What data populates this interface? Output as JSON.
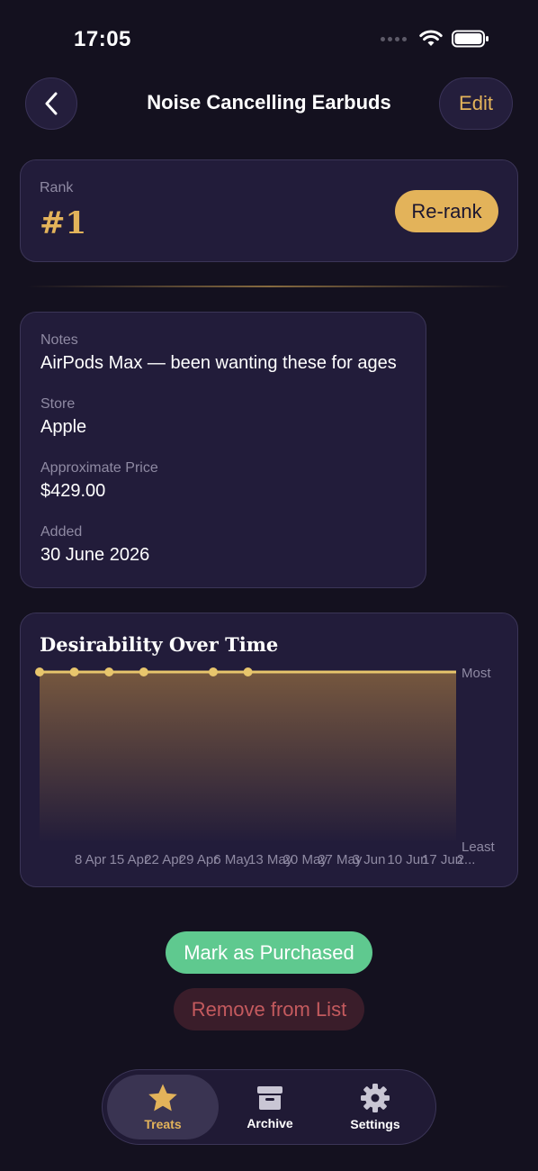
{
  "status": {
    "time": "17:05"
  },
  "nav": {
    "title": "Noise Cancelling Earbuds",
    "edit_label": "Edit"
  },
  "rank": {
    "label": "Rank",
    "value": "#1",
    "rerank_label": "Re-rank"
  },
  "details": [
    {
      "label": "Notes",
      "value": "AirPods Max — been wanting these for ages"
    },
    {
      "label": "Store",
      "value": "Apple"
    },
    {
      "label": "Approximate Price",
      "value": "$429.00"
    },
    {
      "label": "Added",
      "value": "30 June 2026"
    }
  ],
  "chart_data": {
    "type": "area",
    "title": "Desirability Over Time",
    "y_top_label": "Most",
    "y_bottom_label": "Least",
    "x_tick_labels": [
      "8 Apr",
      "15 Apr",
      "22 Apr",
      "29 Apr",
      "6 May",
      "13 May",
      "20 May",
      "27 May",
      "3 Jun",
      "10 Jun",
      "17 Jun",
      "2..."
    ],
    "point_indices": [
      0,
      1,
      2,
      3,
      5,
      6
    ],
    "values": [
      1,
      1,
      1,
      1,
      1,
      1
    ],
    "ylim": [
      0,
      1
    ],
    "line_color": "#e8c56c"
  },
  "actions": {
    "purchase_label": "Mark as Purchased",
    "remove_label": "Remove from List"
  },
  "tabs": [
    {
      "label": "Treats",
      "icon": "star-icon",
      "active": true
    },
    {
      "label": "Archive",
      "icon": "archive-box-icon",
      "active": false
    },
    {
      "label": "Settings",
      "icon": "gear-icon",
      "active": false
    }
  ]
}
